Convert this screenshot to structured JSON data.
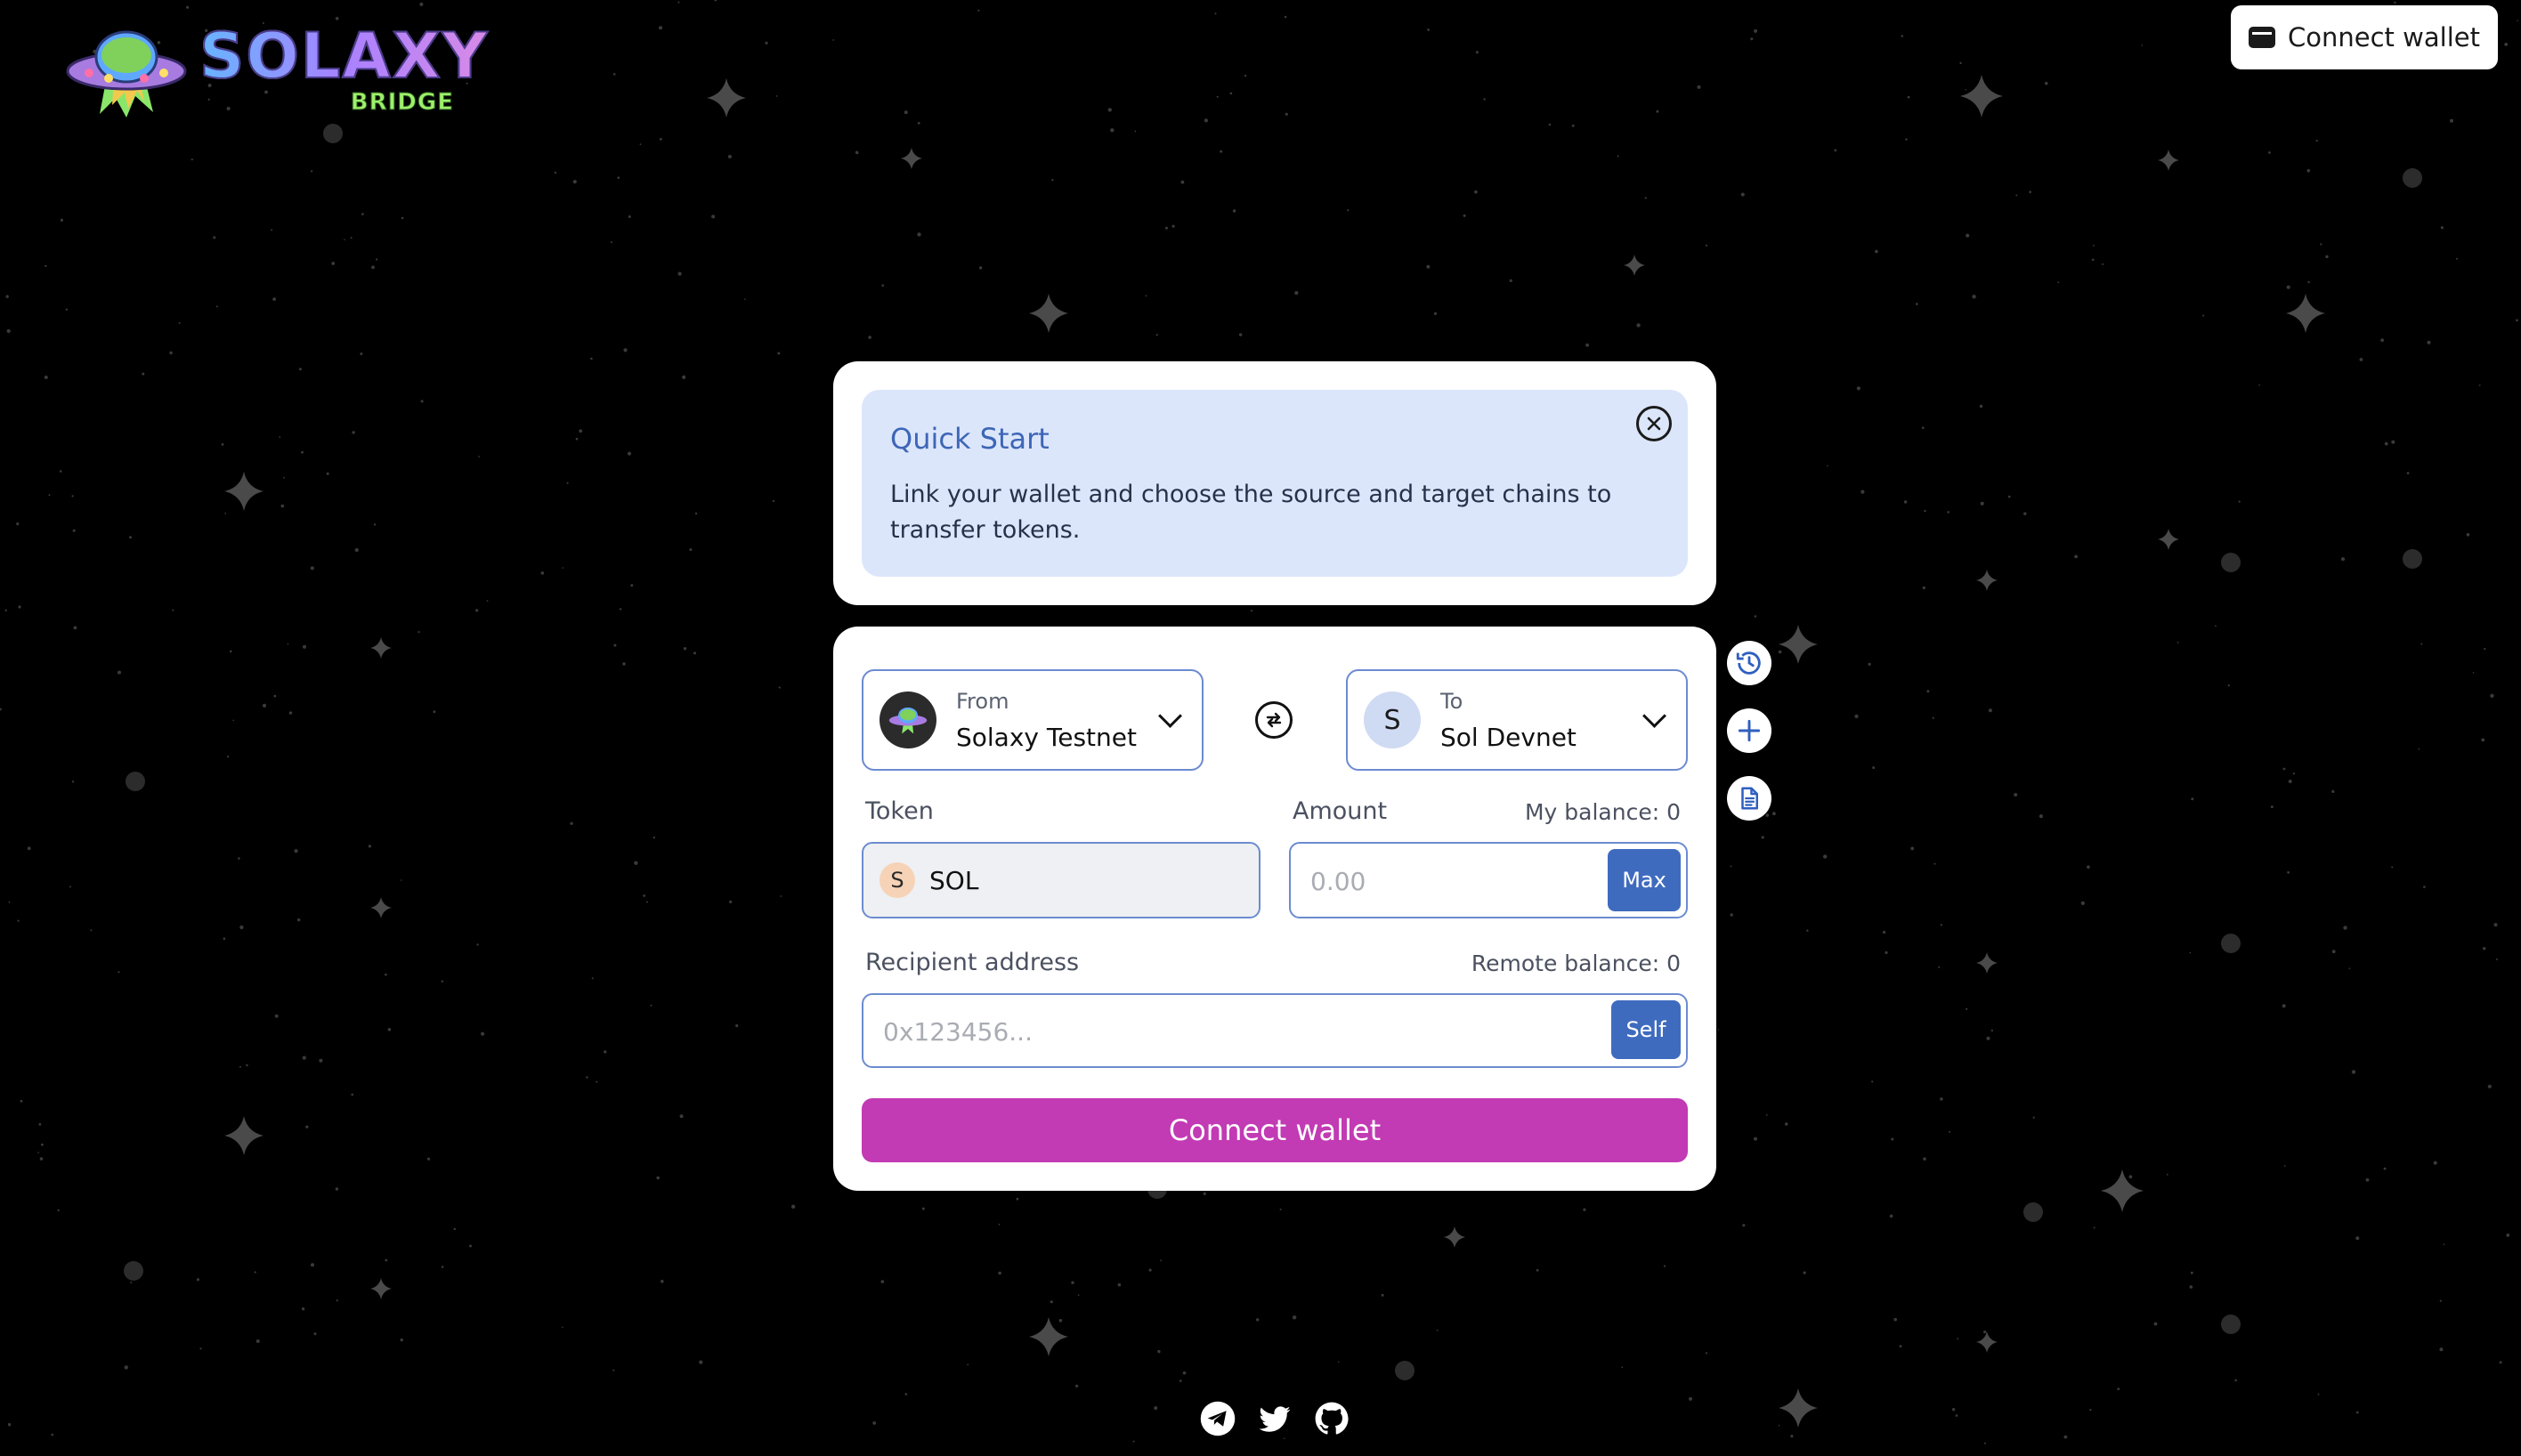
{
  "brand": {
    "name": "SOLAXY",
    "sub": "BRIDGE"
  },
  "header": {
    "connect_label": "Connect wallet",
    "connect_icon": "wallet-icon"
  },
  "quick_start": {
    "title": "Quick Start",
    "text": "Link your wallet and choose the source and target chains to transfer tokens.",
    "close_icon": "close-icon"
  },
  "bridge": {
    "from": {
      "label": "From",
      "chain": "Solaxy Testnet",
      "icon": "solaxy-ufo-icon"
    },
    "to": {
      "label": "To",
      "chain": "Sol Devnet",
      "avatar": "S"
    },
    "swap_icon": "swap-icon",
    "token": {
      "label": "Token",
      "symbol": "SOL",
      "avatar": "S"
    },
    "amount": {
      "label": "Amount",
      "balance": "My balance: 0",
      "placeholder": "0.00",
      "max_label": "Max"
    },
    "recipient": {
      "label": "Recipient address",
      "balance": "Remote balance: 0",
      "placeholder": "0x123456...",
      "self_label": "Self"
    },
    "submit_label": "Connect wallet"
  },
  "side_actions": [
    "history-icon",
    "add-icon",
    "document-icon"
  ],
  "footer": {
    "links": [
      "telegram-icon",
      "twitter-icon",
      "github-icon"
    ]
  },
  "colors": {
    "accent": "#c23ab4",
    "primary": "#3f6bbf",
    "border": "#6c8bd0",
    "quick_bg": "#dce6fb"
  }
}
